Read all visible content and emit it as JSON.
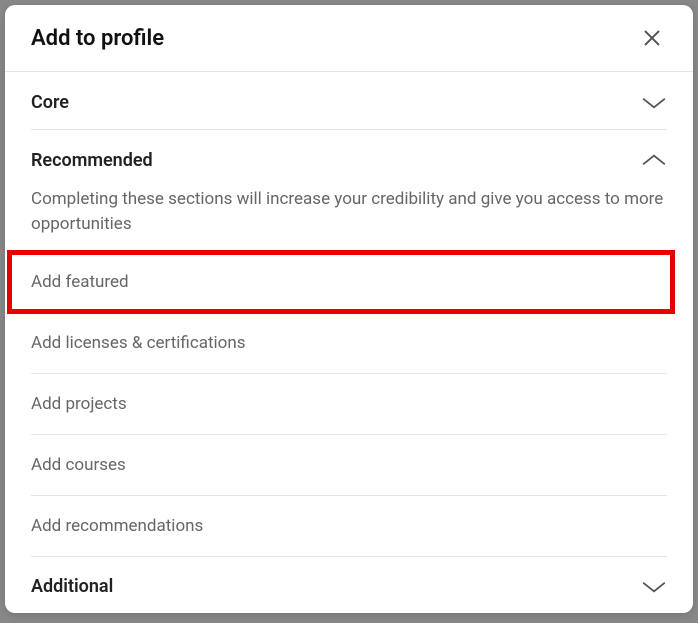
{
  "modal": {
    "title": "Add to profile"
  },
  "sections": {
    "core": {
      "title": "Core"
    },
    "recommended": {
      "title": "Recommended",
      "description": "Completing these sections will increase your credibility and give you access to more opportunities",
      "items": [
        {
          "label": "Add featured"
        },
        {
          "label": "Add licenses & certifications"
        },
        {
          "label": "Add projects"
        },
        {
          "label": "Add courses"
        },
        {
          "label": "Add recommendations"
        }
      ]
    },
    "additional": {
      "title": "Additional"
    }
  }
}
